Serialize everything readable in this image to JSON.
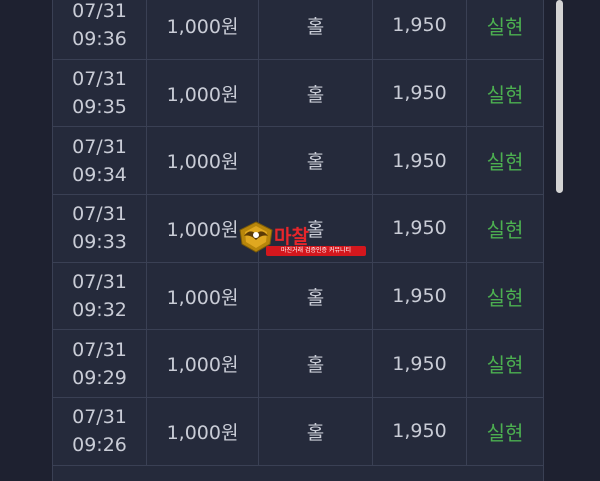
{
  "rows": [
    {
      "date": "07/31",
      "time": "09:36",
      "amount": "1,000원",
      "pick": "홀",
      "odds": "1,950",
      "result": "실현"
    },
    {
      "date": "07/31",
      "time": "09:35",
      "amount": "1,000원",
      "pick": "홀",
      "odds": "1,950",
      "result": "실현"
    },
    {
      "date": "07/31",
      "time": "09:34",
      "amount": "1,000원",
      "pick": "홀",
      "odds": "1,950",
      "result": "실현"
    },
    {
      "date": "07/31",
      "time": "09:33",
      "amount": "1,000원",
      "pick": "홀",
      "odds": "1,950",
      "result": "실현"
    },
    {
      "date": "07/31",
      "time": "09:32",
      "amount": "1,000원",
      "pick": "홀",
      "odds": "1,950",
      "result": "실현"
    },
    {
      "date": "07/31",
      "time": "09:29",
      "amount": "1,000원",
      "pick": "홀",
      "odds": "1,950",
      "result": "실현"
    },
    {
      "date": "07/31",
      "time": "09:26",
      "amount": "1,000원",
      "pick": "홀",
      "odds": "1,950",
      "result": "실현"
    }
  ],
  "watermark": {
    "title": "마찰",
    "title_suffix": "",
    "subtitle": "마진거래 검증인증 커뮤니티"
  },
  "colors": {
    "background": "#1e2130",
    "table_bg": "#252a3b",
    "grid_line": "#3a4054",
    "text": "#c9ccd6",
    "result_green": "#4caf50",
    "watermark_red": "#e8262b"
  }
}
